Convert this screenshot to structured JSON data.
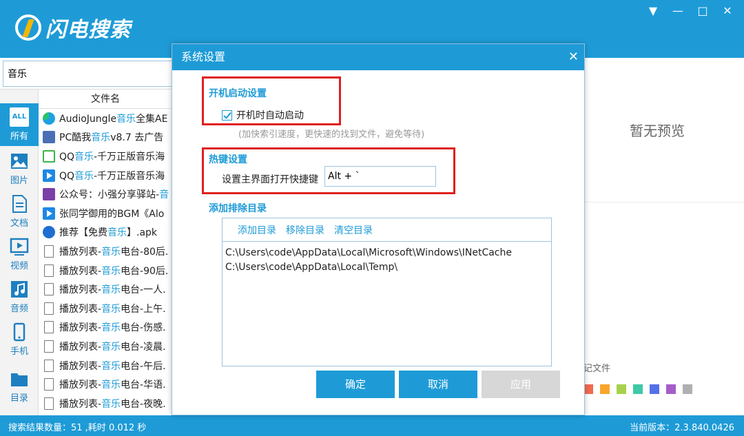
{
  "app": {
    "title": "闪电搜索",
    "window_controls": [
      "▼",
      "—",
      "□",
      "✕"
    ]
  },
  "search": {
    "value": "音乐"
  },
  "sidebar": {
    "categories": [
      {
        "label": "所有",
        "icon": "all-icon",
        "icon_text": "ALL"
      },
      {
        "label": "图片",
        "icon": "image-icon"
      },
      {
        "label": "文档",
        "icon": "document-icon"
      },
      {
        "label": "视频",
        "icon": "video-icon"
      },
      {
        "label": "音频",
        "icon": "audio-icon"
      },
      {
        "label": "手机",
        "icon": "phone-icon"
      },
      {
        "label": "目录",
        "icon": "folder-icon"
      }
    ]
  },
  "filelist": {
    "column_header": "文件名",
    "rows": [
      {
        "pre": "AudioJungle",
        "hl": "音乐",
        "post": "全集AE",
        "icon": "edge-icon"
      },
      {
        "pre": "PC酷我",
        "hl": "音乐",
        "post": "v8.7 去广告",
        "icon": "zip-icon"
      },
      {
        "pre": "QQ",
        "hl": "音乐",
        "post": "-千万正版音乐海",
        "icon": "qq-file-icon"
      },
      {
        "pre": "QQ",
        "hl": "音乐",
        "post": "-千万正版音乐海",
        "icon": "play-icon"
      },
      {
        "pre": "公众号：小强分享驿站-",
        "hl": "音",
        "post": "",
        "icon": "rar-icon"
      },
      {
        "pre": "张同学御用的BGM《Alo",
        "hl": "",
        "post": "",
        "icon": "play-icon"
      },
      {
        "pre": "推荐【免费",
        "hl": "音乐",
        "post": "】.apk",
        "icon": "apk-icon"
      },
      {
        "pre": "播放列表-",
        "hl": "音乐",
        "post": "电台-80后.",
        "icon": "file-icon"
      },
      {
        "pre": "播放列表-",
        "hl": "音乐",
        "post": "电台-90后.",
        "icon": "file-icon"
      },
      {
        "pre": "播放列表-",
        "hl": "音乐",
        "post": "电台-一人.",
        "icon": "file-icon"
      },
      {
        "pre": "播放列表-",
        "hl": "音乐",
        "post": "电台-上午.",
        "icon": "file-icon"
      },
      {
        "pre": "播放列表-",
        "hl": "音乐",
        "post": "电台-伤感.",
        "icon": "file-icon"
      },
      {
        "pre": "播放列表-",
        "hl": "音乐",
        "post": "电台-凌晨.",
        "icon": "file-icon"
      },
      {
        "pre": "播放列表-",
        "hl": "音乐",
        "post": "电台-午后.",
        "icon": "file-icon"
      },
      {
        "pre": "播放列表-",
        "hl": "音乐",
        "post": "电台-华语.",
        "icon": "file-icon"
      },
      {
        "pre": "播放列表-",
        "hl": "音乐",
        "post": "电台-夜晚.",
        "icon": "file-icon"
      }
    ]
  },
  "preview": {
    "empty_text": "暂无预览",
    "mark_label": "记文件",
    "swatch_colors": [
      "#f26a4f",
      "#f9a62b",
      "#a9d04c",
      "#3ec9a7",
      "#5470e8",
      "#a45ec9",
      "#b0b0b0"
    ]
  },
  "status": {
    "left": "搜索结果数量：51 ,耗时 0.012 秒",
    "right": "当前版本：2.3.840.0426"
  },
  "dialog": {
    "title": "系统设置",
    "startup_section": "开机启动设置",
    "autostart_label": "开机时自动启动",
    "autostart_checked": true,
    "hint": "(加快索引速度，更快速的找到文件，避免等待)",
    "hotkey_section": "热键设置",
    "hotkey_label": "设置主界面打开快捷键",
    "hotkey_value": "Alt + `",
    "exclude_section": "添加排除目录",
    "add_dir": "添加目录",
    "remove_dir": "移除目录",
    "clear_dir": "清空目录",
    "exclude_paths": [
      "C:\\Users\\code\\AppData\\Local\\Microsoft\\Windows\\INetCache",
      "C:\\Users\\code\\AppData\\Local\\Temp\\"
    ],
    "ok": "确定",
    "cancel": "取消",
    "apply": "应用"
  }
}
